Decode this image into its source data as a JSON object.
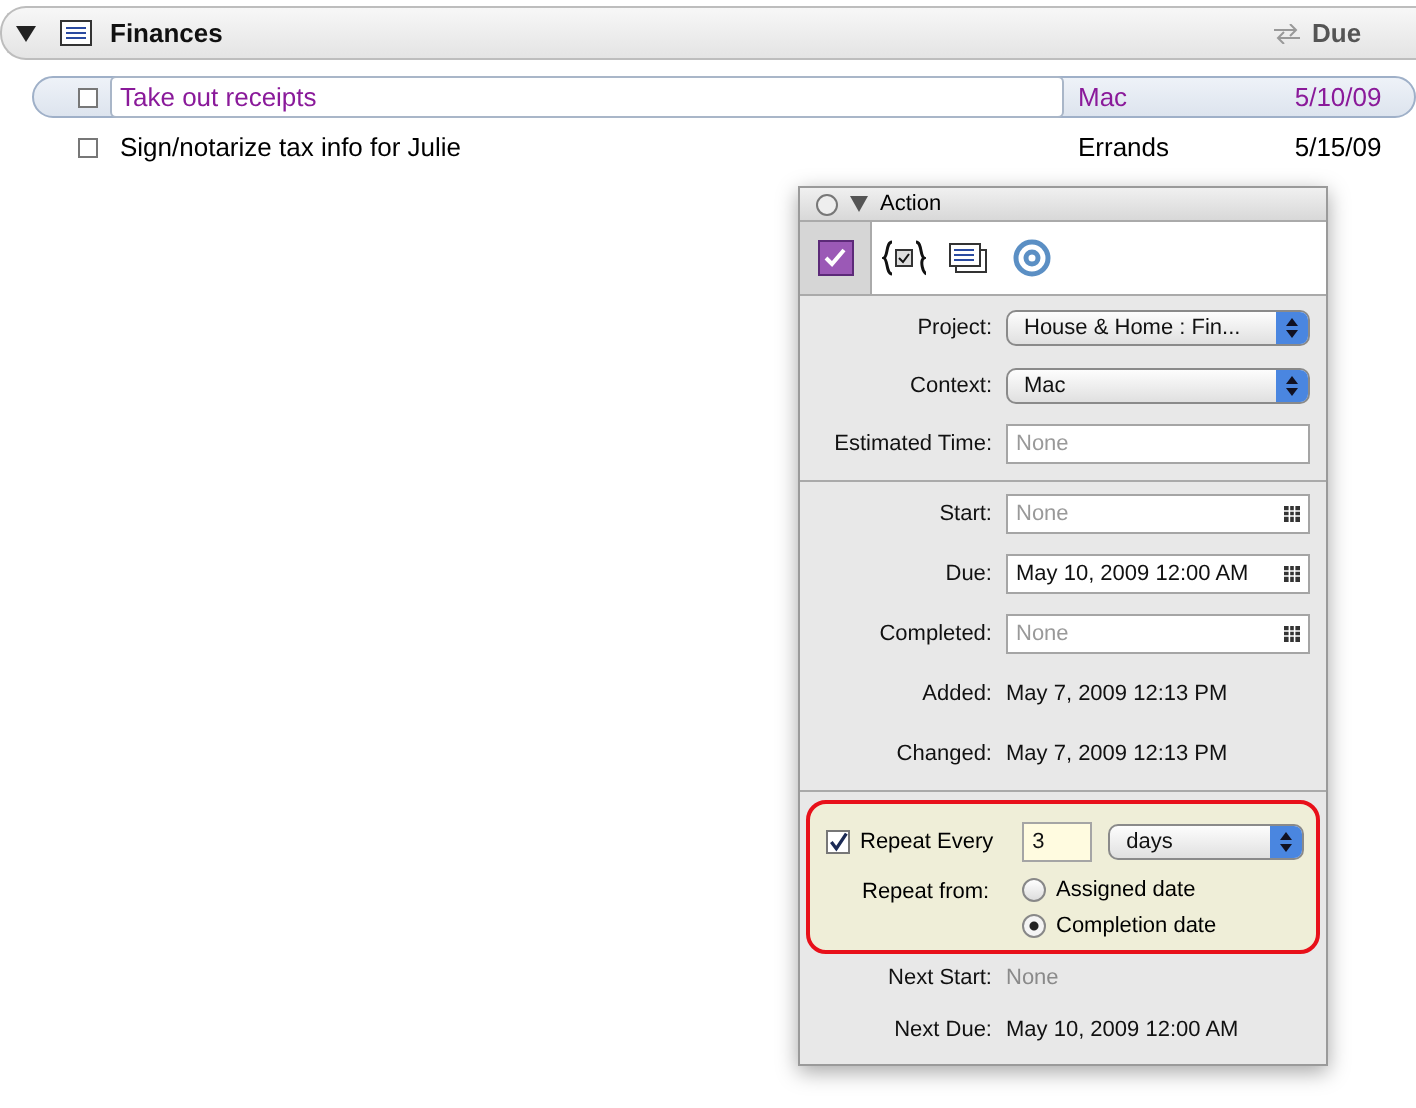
{
  "outline": {
    "title": "Finances",
    "expanded": true,
    "due_column": "Due",
    "rows": [
      {
        "title": "Take out receipts",
        "context": "Mac",
        "due": "5/10/09",
        "checked": false,
        "selected": true
      },
      {
        "title": "Sign/notarize tax info for Julie",
        "context": "Errands",
        "due": "5/15/09",
        "checked": false,
        "selected": false
      }
    ]
  },
  "inspector": {
    "title": "Action",
    "tabs": [
      {
        "kind": "action",
        "selected": true
      },
      {
        "kind": "context",
        "selected": false
      },
      {
        "kind": "list",
        "selected": false
      },
      {
        "kind": "at",
        "selected": false
      }
    ],
    "sections": [
      [
        {
          "kind": "select",
          "label": "Project:",
          "value": "House & Home : Fin..."
        },
        {
          "kind": "select",
          "label": "Context:",
          "value": "Mac"
        },
        {
          "kind": "input",
          "label": "Estimated Time:",
          "placeholder": "None"
        }
      ],
      [
        {
          "kind": "date",
          "label": "Start:",
          "placeholder": "None"
        },
        {
          "kind": "date",
          "label": "Due:",
          "value": "May 10, 2009 12:00 AM"
        },
        {
          "kind": "date",
          "label": "Completed:",
          "placeholder": "None"
        },
        {
          "kind": "info",
          "label": "Added:",
          "value": "May 7, 2009 12:13 PM"
        },
        {
          "kind": "info",
          "label": "Changed:",
          "value": "May 7, 2009 12:13 PM"
        }
      ]
    ],
    "repeat": {
      "label": "Repeat Every",
      "checked": true,
      "every": "3",
      "unit": "days",
      "from_label": "Repeat from:",
      "options": [
        {
          "label": "Assigned date",
          "selected": false
        },
        {
          "label": "Completion date",
          "selected": true
        }
      ]
    },
    "next": [
      {
        "label": "Next Start:",
        "value": "None",
        "muted": true
      },
      {
        "label": "Next Due:",
        "value": "May 10, 2009 12:00 AM",
        "muted": false
      }
    ]
  }
}
